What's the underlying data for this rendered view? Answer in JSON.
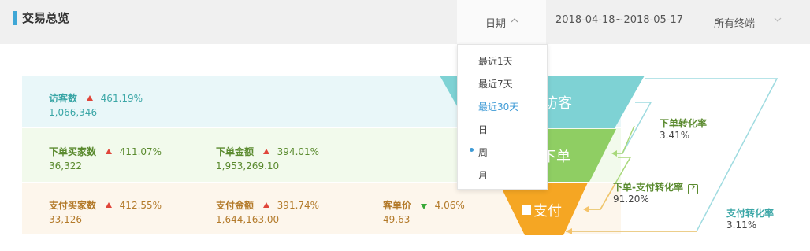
{
  "header": {
    "title": "交易总览",
    "date_label": "日期",
    "date_range": "2018-04-18~2018-05-17",
    "terminal": "所有终端"
  },
  "date_dropdown": {
    "options": [
      "最近1天",
      "最近7天",
      "最近30天",
      "日",
      "周",
      "月"
    ],
    "selected": "最近30天"
  },
  "metrics": {
    "visitors": {
      "label": "访客数",
      "change": "461.19%",
      "value": "1,066,346",
      "trend": "up"
    },
    "order_buyers": {
      "label": "下单买家数",
      "change": "411.07%",
      "value": "36,322",
      "trend": "up"
    },
    "order_amount": {
      "label": "下单金额",
      "change": "394.01%",
      "value": "1,953,269.10",
      "trend": "up"
    },
    "pay_buyers": {
      "label": "支付买家数",
      "change": "412.55%",
      "value": "33,126",
      "trend": "up"
    },
    "pay_amount": {
      "label": "支付金额",
      "change": "391.74%",
      "value": "1,644,163.00",
      "trend": "up"
    },
    "unit_price": {
      "label": "客单价",
      "change": "4.06%",
      "value": "49.63",
      "trend": "down"
    }
  },
  "funnel": {
    "stages": [
      "访客",
      "下单",
      "支付"
    ],
    "stage_colors": [
      "#7ed2d4",
      "#8fce63",
      "#f5a623"
    ]
  },
  "conversions": {
    "order_rate": {
      "label": "下单转化率",
      "value": "3.41%"
    },
    "order_pay_rate": {
      "label": "下单-支付转化率",
      "value": "91.20%",
      "help_icon": "?"
    },
    "pay_rate": {
      "label": "支付转化率",
      "value": "3.11%"
    }
  },
  "colors": {
    "teal": "#3aa6a6",
    "green": "#5a8a2e",
    "orange": "#b37a2a",
    "up": "#e0453a",
    "down": "#38a838",
    "accent": "#3f9bd6"
  }
}
